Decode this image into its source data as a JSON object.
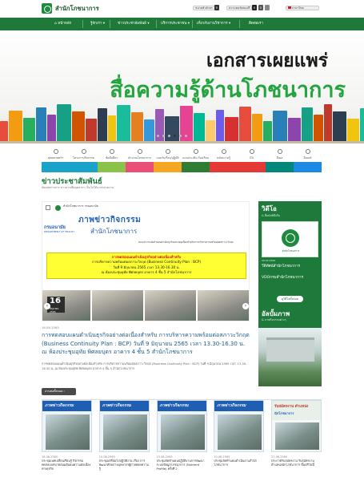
{
  "header": {
    "site_title": "สำนักโภชนาการ",
    "font_size_label": "ขนาดตัวอักษร",
    "contrast_label": "ความคมชัดของสี",
    "lang_label": "ภาษาไทย",
    "size_buttons": [
      "ก",
      "ก",
      "ก"
    ]
  },
  "nav": [
    "หน้าหลัก",
    "รู้จักเรา",
    "ข่าวประชาสัมพันธ์",
    "บริการประชาชน",
    "เกี่ยวกับงานวิชาการ",
    "ติดต่อเรา"
  ],
  "banner": {
    "line1": "เอกสารเผยแพร่",
    "line2": "สื่อความรู้ด้านโภชนาการ"
  },
  "quick_links": [
    {
      "label": "ยุทธศาสตร์ฯ",
      "icon": "target-icon"
    },
    {
      "label": "โครงการ/กิจกรรม",
      "icon": "folder-icon"
    },
    {
      "label": "ข้อมือสื่อฯ",
      "icon": "book-icon"
    },
    {
      "label": "คำนวณโภชนาการ",
      "icon": "calculator-icon"
    },
    {
      "label": "แบบรับเรื่อง/ปฏิบัติ",
      "icon": "document-icon"
    },
    {
      "label": "แบบประเมิน ร้องเรียน",
      "icon": "chat-icon"
    },
    {
      "label": "คลังความรู้",
      "icon": "library-icon"
    },
    {
      "label": "ITA",
      "icon": "shield-icon"
    },
    {
      "label": "อีเมล",
      "icon": "mail-icon"
    },
    {
      "label": "อีเมลล์",
      "icon": "globe-icon"
    }
  ],
  "news": {
    "heading": "ข่าวประชาสัมพันธ์",
    "subheading": "อัพเดทข่าวสาร ข่าวสารเพื่อบุคลากร เป็นไปได้จากหน่วยงาน",
    "featured": {
      "dept_th": "สำนักโภชนาการ กรมอนามัย",
      "pr_big": "ภาพข่าวกิจกรรม",
      "pr_sub": "สำนักโภชนาการ",
      "dept_name": "กรมอนามัย",
      "dept_en": "DEPARTMENT OF HEALTH",
      "note": "คณะทำงานจัดทำแผนดำเนินธุรกิจอย่างต่อเนื่องสำหรับการบริหารความพร้อมต่อสภาวะวิกฤต",
      "yellow_l1": "การทดสอบแผนดำเนินธุรกิจอย่างต่อเนื่องสำหรับ",
      "yellow_l2": "การบริหารความพร้อมต่อสภาวะวิกฤต (Business Continuity Plan : BCP)",
      "yellow_l3": "วันที่ 9 มิถุนายน 2565 เวลา 13.30-16.30 น.",
      "yellow_l4": "ณ ห้องประชุมอุทัย พิศลยบุตร อาคาร 4 ชั้น 5 สำนักโภชนาการ",
      "date_day": "16",
      "date_month": "มิถุนายน 2565"
    },
    "article_date": "16.06.2565",
    "article_title": "การทดสอบแผนดำเนินธุรกิจอย่างต่อเนื่องสำหรับ การบริหารความพร้อมต่อสภาวะวิกฤต (Business Continuity Plan : BCP) วันที่ 9 มิถุนายน 2565 เวลา 13.30-16.30 น. ณ ห้องประชุมอุทัย พิศลยบุตร อาคาร 4 ชั้น 5 สำนักโภชนาการ",
    "article_desc": "การทดสอบแผนดำเนินธุรกิจอย่างต่อเนื่องสำหรับ การบริหารความพร้อมต่อสภาวะวิกฤต (Business Continuity Plan : BCP) วันที่ 9 มิถุนายน 2565 เวลา 13.30-16.30 น. ณ ห้องประชุมอุทัย พิศลยบุตร อาคาร 4 ชั้น 5 สำนักโภชนาการ",
    "readmore": "อ่านต่อทั้งหมด",
    "cards": [
      {
        "date": "16.06.2565",
        "title": "ประชุมเพทเปลี่ยนเรียนรู้ กิจกรรมทดสอบบทบาทสมมติแผนความต่อเนื่องทางธุรกิจ",
        "banner": "ภาพข่าวกิจกรรม"
      },
      {
        "date": "10.06.2565",
        "title": "ประชุมเตรียมไปปฏิบัติงาน เรื่อง การพัฒนาศักยภาพบุคลากรผู้ถ่ายทอดความรู้",
        "banner": "ภาพข่าวกิจกรรม"
      },
      {
        "date": "10.06.2565",
        "title": "ประชุมจัดทำแผนปฏิบัติงานการพัฒนาระบบข้อมูลโภชนาการ (Nutrient Profile) ครั้งที่ 2",
        "banner": "ภาพข่าวกิจกรรม"
      },
      {
        "date": "10.06.2565",
        "title": "ประชุมจัดทำแผนดำเนินงานสำนักโภชนาการ",
        "banner": "ภาพข่าวกิจกรรม"
      },
      {
        "date": "21.06.2565",
        "title": "ประกาศรับสมัครงาน รับสมัครงานตำแหน่งนักโภชนาการ ชั้นตรีวันนี้",
        "hdr1": "รับสมัครงาน ตำแหน่ง",
        "hdr2": "นักโภชนาการ"
      }
    ]
  },
  "sidebar": {
    "tv_title": "วิดีโอ",
    "tv_sub": "& สื่อมัลติมีเดีย",
    "tv_thumb_label": "สำนักโภชนาการ",
    "tv_date": "26.03.2566",
    "tv_cap1": "วีดิทัศน์สำนักโภชนาการ",
    "tv_cap2": "VDOกรมสำนักโภชนาการ",
    "tv_all": "ดูวิดีโอทั้งหมด",
    "gallery_title": "อัลบั้มภาพ",
    "gallery_sub": "& ภาพกิจกรรมต่างๆ"
  },
  "colors": {
    "brand_green": "#1f7a3a",
    "accent_green": "#23a43f",
    "link_blue": "#1d5c8c",
    "highlight_yellow": "#ffff33"
  }
}
